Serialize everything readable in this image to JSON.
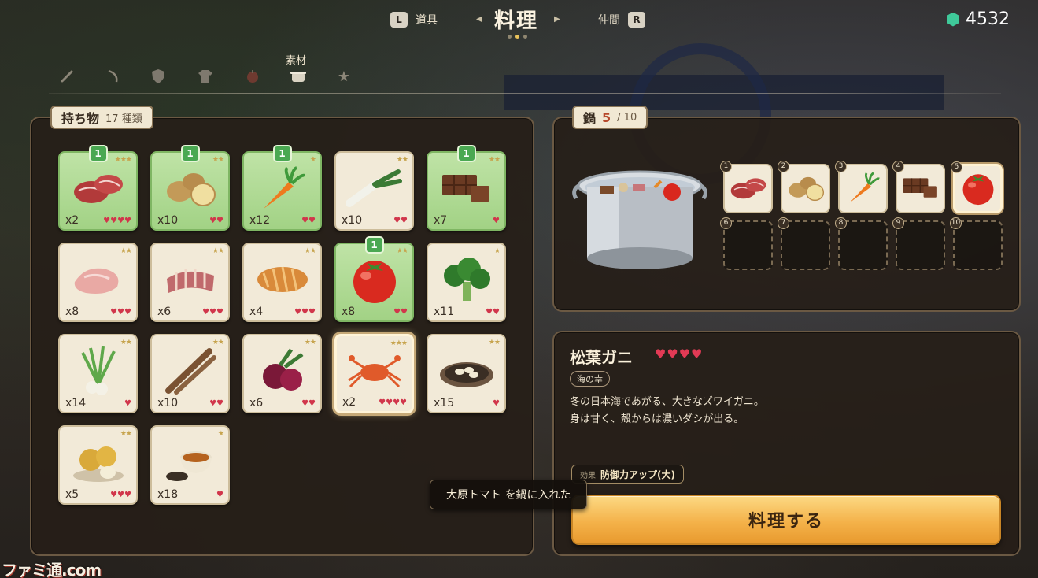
{
  "topbar": {
    "left_key": "L",
    "left_tab": "道具",
    "current_tab": "料理",
    "right_tab": "仲間",
    "right_key": "R",
    "currency_value": "4532"
  },
  "categories": {
    "active_label": "素材",
    "icons": [
      "weapon-icon",
      "bow-icon",
      "shield-icon",
      "shirt-icon",
      "fruit-icon",
      "pot-icon",
      "star-icon"
    ]
  },
  "inventory": {
    "title": "持ち物",
    "count_text": "17 種類",
    "items": [
      {
        "name": "beef",
        "qty": "x2",
        "stars": "★★★",
        "hearts": "♥♥♥♥",
        "green": true,
        "badge": "1"
      },
      {
        "name": "potato",
        "qty": "x10",
        "stars": "★★",
        "hearts": "♥♥",
        "green": true,
        "badge": "1"
      },
      {
        "name": "carrot",
        "qty": "x12",
        "stars": "★",
        "hearts": "♥♥",
        "green": true,
        "badge": "1"
      },
      {
        "name": "leek",
        "qty": "x10",
        "stars": "★★",
        "hearts": "♥♥",
        "green": false,
        "badge": ""
      },
      {
        "name": "chocolate",
        "qty": "x7",
        "stars": "★★",
        "hearts": "♥",
        "green": true,
        "badge": "1"
      },
      {
        "name": "pork",
        "qty": "x8",
        "stars": "★★",
        "hearts": "♥♥♥",
        "green": false,
        "badge": ""
      },
      {
        "name": "ribs",
        "qty": "x6",
        "stars": "★★",
        "hearts": "♥♥♥",
        "green": false,
        "badge": ""
      },
      {
        "name": "cutlet",
        "qty": "x4",
        "stars": "★★",
        "hearts": "♥♥♥",
        "green": false,
        "badge": ""
      },
      {
        "name": "tomato",
        "qty": "x8",
        "stars": "★★",
        "hearts": "♥♥",
        "green": true,
        "badge": "1"
      },
      {
        "name": "broccoli",
        "qty": "x11",
        "stars": "★",
        "hearts": "♥♥",
        "green": false,
        "badge": ""
      },
      {
        "name": "scallion",
        "qty": "x14",
        "stars": "★★",
        "hearts": "♥",
        "green": false,
        "badge": ""
      },
      {
        "name": "burdock",
        "qty": "x10",
        "stars": "★★",
        "hearts": "♥♥",
        "green": false,
        "badge": ""
      },
      {
        "name": "beet",
        "qty": "x6",
        "stars": "★★",
        "hearts": "♥♥",
        "green": false,
        "badge": ""
      },
      {
        "name": "crab",
        "qty": "x2",
        "stars": "★★★",
        "hearts": "♥♥♥♥",
        "green": false,
        "badge": "",
        "selected": true
      },
      {
        "name": "garlic",
        "qty": "x15",
        "stars": "★★",
        "hearts": "♥",
        "green": false,
        "badge": ""
      },
      {
        "name": "pear",
        "qty": "x5",
        "stars": "★★",
        "hearts": "♥♥♥",
        "green": false,
        "badge": ""
      },
      {
        "name": "tea",
        "qty": "x18",
        "stars": "★",
        "hearts": "♥",
        "green": false,
        "badge": ""
      }
    ]
  },
  "pot": {
    "title": "鍋",
    "current": "5",
    "max": "/ 10",
    "slots": [
      {
        "num": "1",
        "item": "beef"
      },
      {
        "num": "2",
        "item": "potato"
      },
      {
        "num": "3",
        "item": "carrot"
      },
      {
        "num": "4",
        "item": "chocolate"
      },
      {
        "num": "5",
        "item": "tomato",
        "active": true
      },
      {
        "num": "6",
        "item": ""
      },
      {
        "num": "7",
        "item": ""
      },
      {
        "num": "8",
        "item": ""
      },
      {
        "num": "9",
        "item": ""
      },
      {
        "num": "10",
        "item": ""
      }
    ]
  },
  "detail": {
    "name": "松葉ガニ",
    "hearts": "♥♥♥♥",
    "category": "海の幸",
    "description_line1": "冬の日本海であがる、大きなズワイガニ。",
    "description_line2": "身は甘く、殻からは濃いダシが出る。",
    "effect_key": "効果",
    "effect_value": "防御力アップ(大)",
    "cook_button": "料理する"
  },
  "toast": "大原トマト を鍋に入れた",
  "watermark": "ファミ通.com",
  "colors": {
    "panel_border": "#6b5943",
    "card_green": "#a2d285",
    "heart": "#d1364b",
    "cook_button": "#f4b24a",
    "gem": "#3fc99a"
  }
}
